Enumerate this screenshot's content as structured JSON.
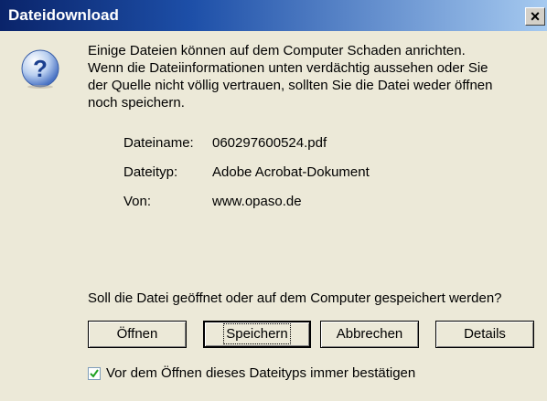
{
  "window": {
    "title": "Dateidownload",
    "close_label": "×"
  },
  "dialog": {
    "icon": "question-mark-icon",
    "message": [
      "Einige Dateien können auf dem Computer Schaden anrichten.",
      "Wenn die Dateiinformationen unten verdächtig aussehen oder Sie",
      "der Quelle nicht völlig vertrauen, sollten Sie die Datei weder öffnen",
      "noch speichern."
    ],
    "info": [
      {
        "label": "Dateiname:",
        "value": "060297600524.pdf"
      },
      {
        "label": "Dateityp:",
        "value": "Adobe Acrobat-Dokument"
      },
      {
        "label": "Von:",
        "value": "www.opaso.de"
      }
    ],
    "question": "Soll die Datei geöffnet oder auf dem Computer gespeichert werden?",
    "buttons": {
      "open": "Öffnen",
      "save": "Speichern",
      "cancel": "Abbrechen",
      "details": "Details"
    },
    "checkbox": {
      "label": "Vor dem Öffnen dieses Dateityps immer bestätigen",
      "checked": true
    }
  }
}
